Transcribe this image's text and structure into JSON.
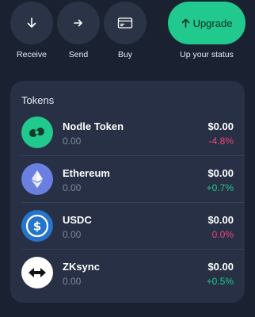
{
  "actions": {
    "receive_label": "Receive",
    "send_label": "Send",
    "buy_label": "Buy",
    "upgrade_button_label": "Upgrade",
    "upgrade_caption": "Up your status"
  },
  "tokens_card": {
    "title": "Tokens",
    "items": [
      {
        "name": "Nodle Token",
        "balance": "0.00",
        "value": "$0.00",
        "change": "-4.8%",
        "change_color": "#f0457a",
        "icon": "nodle-icon",
        "icon_bg": "#21c98e"
      },
      {
        "name": "Ethereum",
        "balance": "0.00",
        "value": "$0.00",
        "change": "+0.7%",
        "change_color": "#21c98e",
        "icon": "ethereum-icon",
        "icon_bg": "#6a7fe0"
      },
      {
        "name": "USDC",
        "balance": "0.00",
        "value": "$0.00",
        "change": "0.0%",
        "change_color": "#f0457a",
        "icon": "usdc-icon",
        "icon_bg": "#2775ca"
      },
      {
        "name": "ZKsync",
        "balance": "0.00",
        "value": "$0.00",
        "change": "+0.5%",
        "change_color": "#21c98e",
        "icon": "zksync-icon",
        "icon_bg": "#ffffff"
      }
    ]
  },
  "colors": {
    "background": "#1a2232",
    "card": "#273044",
    "accent_green": "#21c98e",
    "negative_pink": "#f0457a",
    "muted_text": "#7d879a"
  }
}
